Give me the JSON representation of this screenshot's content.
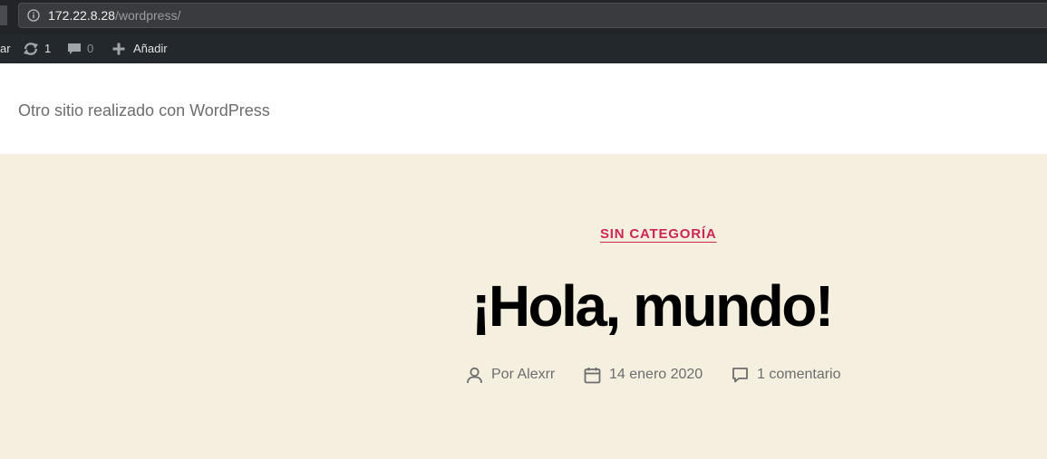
{
  "browser": {
    "url_host": "172.22.8.28",
    "url_path": "/wordpress/"
  },
  "admin_bar": {
    "partial_label": "ar",
    "updates_count": "1",
    "comments_count": "0",
    "new_label": "Añadir"
  },
  "site": {
    "description": "Otro sitio realizado con WordPress"
  },
  "post": {
    "category": "SIN CATEGORÍA",
    "title": "¡Hola, mundo!",
    "author": "Por Alexrr",
    "date": "14 enero 2020",
    "comments": "1 comentario"
  },
  "colors": {
    "accent": "#cd2653",
    "post_background": "#f5efe0",
    "admin_bar": "#23282d"
  },
  "icons": [
    "info-icon",
    "updates-icon",
    "comments-icon",
    "plus-icon",
    "author-icon",
    "calendar-icon",
    "comment-icon"
  ]
}
